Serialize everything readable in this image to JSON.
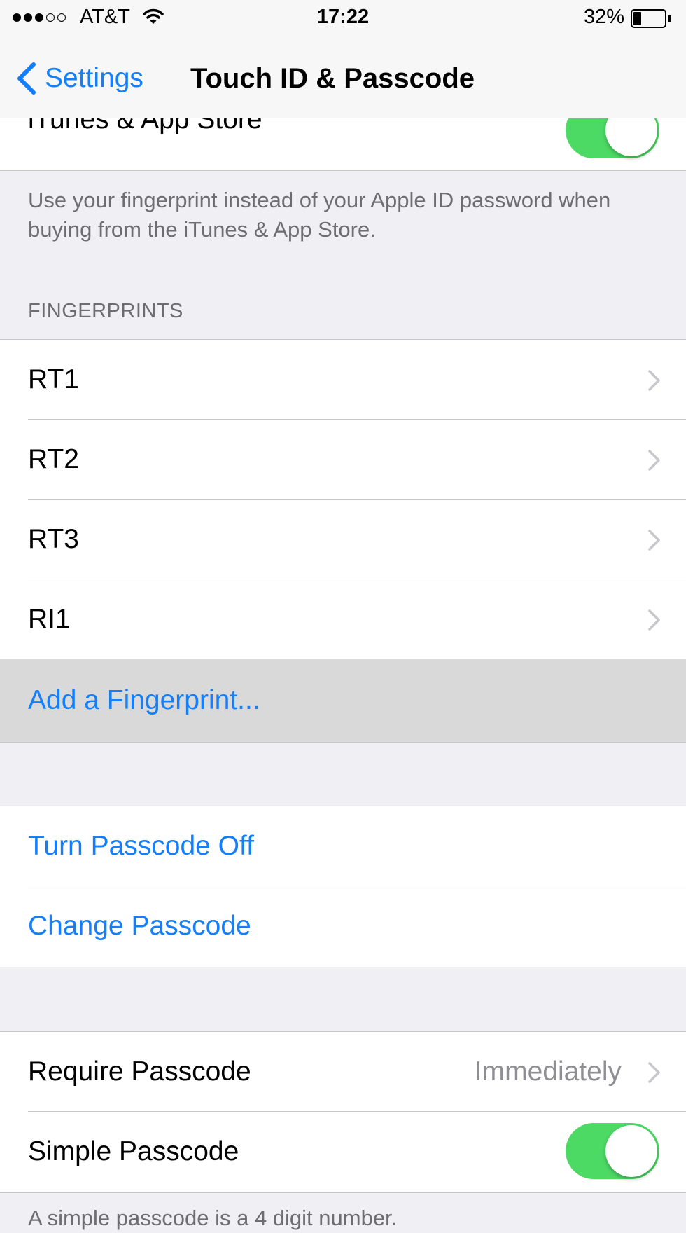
{
  "status_bar": {
    "signal_dots_filled": 3,
    "signal_dots_total": 5,
    "carrier": "AT&T",
    "time": "17:22",
    "battery_percent": "32%",
    "battery_level": 0.32,
    "icons": [
      "wifi-icon",
      "battery-icon"
    ]
  },
  "nav": {
    "back_label": "Settings",
    "title": "Touch ID & Passcode",
    "back_icon": "chevron-left-icon"
  },
  "itunes": {
    "label": "iTunes & App Store",
    "toggle_on": true,
    "footer": "Use your fingerprint instead of your Apple ID password when buying from the iTunes & App Store."
  },
  "fingerprints": {
    "header": "FINGERPRINTS",
    "items": [
      {
        "label": "RT1"
      },
      {
        "label": "RT2"
      },
      {
        "label": "RT3"
      },
      {
        "label": "RI1"
      }
    ],
    "add_label": "Add a Fingerprint..."
  },
  "passcode": {
    "turn_off_label": "Turn Passcode Off",
    "change_label": "Change Passcode"
  },
  "settings": {
    "require_label": "Require Passcode",
    "require_value": "Immediately",
    "simple_label": "Simple Passcode",
    "simple_on": true,
    "footer_partial": "A simple passcode is a 4 digit number."
  },
  "colors": {
    "accent": "#157efb",
    "toggle_on": "#4cd964",
    "background": "#efeff4",
    "highlight": "#d9d9d9"
  }
}
